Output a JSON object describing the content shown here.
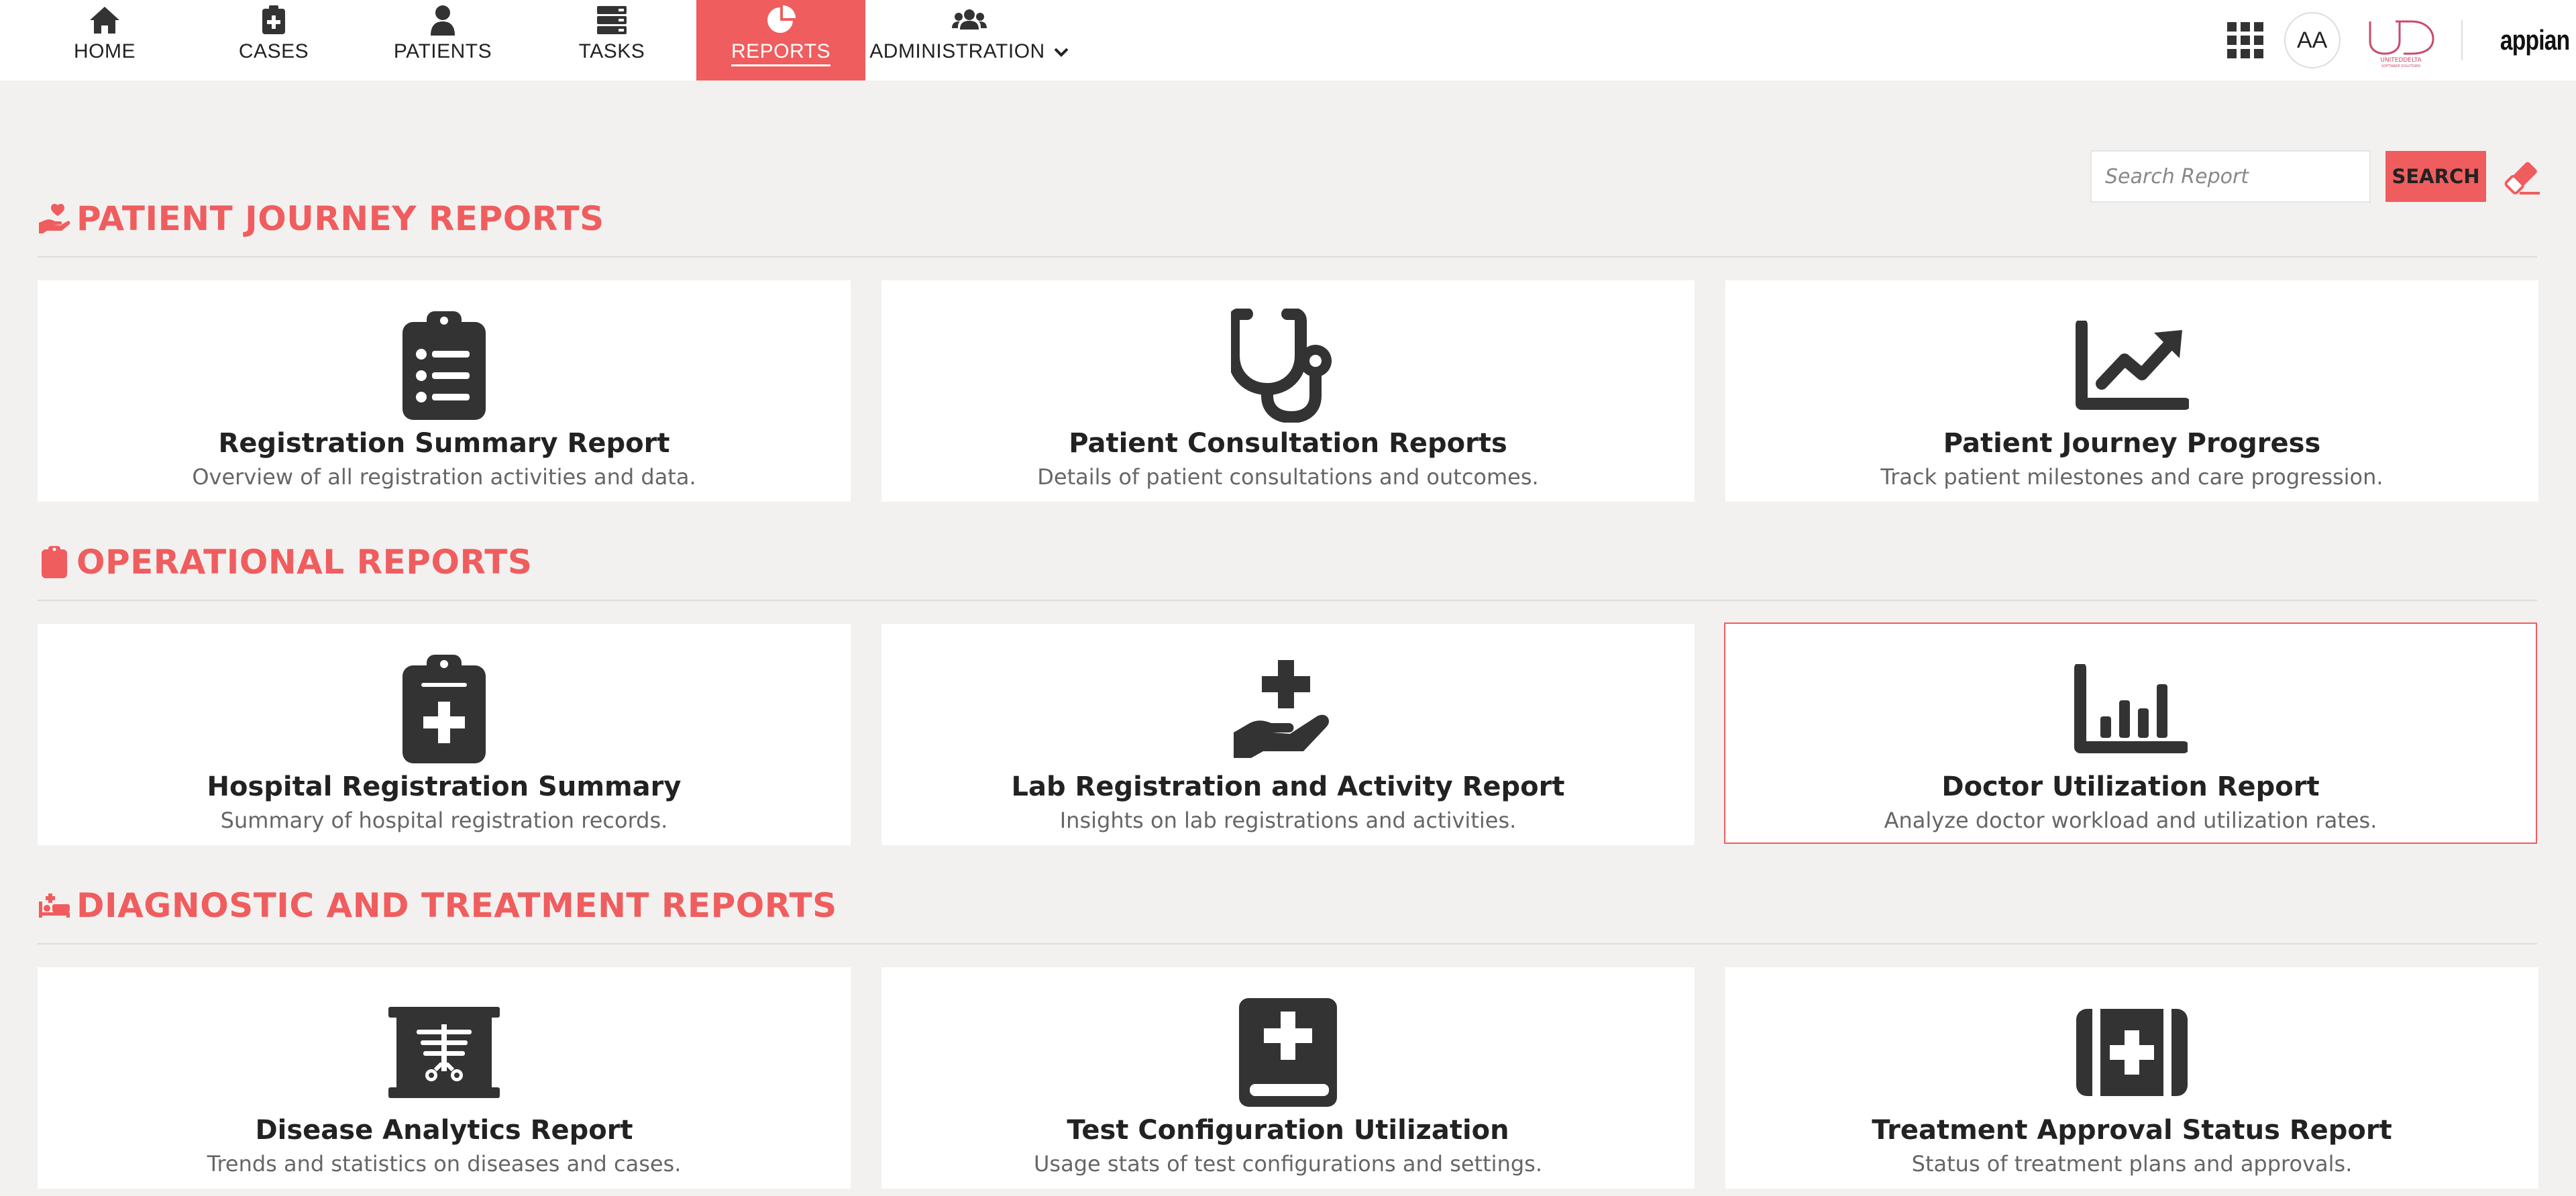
{
  "nav": {
    "items": [
      {
        "label": "HOME",
        "icon": "home-icon"
      },
      {
        "label": "CASES",
        "icon": "cases-icon"
      },
      {
        "label": "PATIENTS",
        "icon": "patients-icon"
      },
      {
        "label": "TASKS",
        "icon": "tasks-icon"
      },
      {
        "label": "REPORTS",
        "icon": "reports-icon",
        "active": true
      },
      {
        "label": "ADMINISTRATION",
        "icon": "administration-icon"
      }
    ]
  },
  "user": {
    "initials": "AA"
  },
  "brand": {
    "appian": "appian",
    "partner_logo": "UNITEDDELTA SOFTWARE SOLUTIONS"
  },
  "search": {
    "placeholder": "Search Report",
    "button_label": "SEARCH"
  },
  "colors": {
    "accent": "#f05d5e",
    "icon": "#333333",
    "background": "#f2f1f0"
  },
  "sections": [
    {
      "title": "PATIENT JOURNEY REPORTS",
      "icon": "hand-holding-heart-icon",
      "cards": [
        {
          "title": "Registration Summary Report",
          "desc": "Overview of all registration activities and data.",
          "icon": "clipboard-list-icon"
        },
        {
          "title": "Patient Consultation Reports",
          "desc": "Details of patient consultations and outcomes.",
          "icon": "stethoscope-icon"
        },
        {
          "title": "Patient Journey Progress",
          "desc": "Track patient milestones and care progression.",
          "icon": "chart-line-icon"
        }
      ]
    },
    {
      "title": "OPERATIONAL REPORTS",
      "icon": "clipboard-icon",
      "cards": [
        {
          "title": "Hospital Registration Summary",
          "desc": "Summary of hospital registration records.",
          "icon": "clipboard-medical-icon"
        },
        {
          "title": "Lab Registration and Activity Report",
          "desc": "Insights on lab registrations and activities.",
          "icon": "hand-holding-medical-icon"
        },
        {
          "title": "Doctor Utilization Report",
          "desc": "Analyze doctor workload and utilization rates.",
          "icon": "chart-bar-icon",
          "selected": true
        }
      ]
    },
    {
      "title": "DIAGNOSTIC AND TREATMENT REPORTS",
      "icon": "procedures-icon",
      "cards": [
        {
          "title": "Disease Analytics Report",
          "desc": "Trends and statistics on diseases and cases.",
          "icon": "x-ray-icon"
        },
        {
          "title": "Test Configuration Utilization",
          "desc": "Usage stats of test configurations and settings.",
          "icon": "book-medical-icon"
        },
        {
          "title": "Treatment Approval Status Report",
          "desc": "Status of treatment plans and approvals.",
          "icon": "first-aid-kit-icon"
        }
      ]
    }
  ]
}
